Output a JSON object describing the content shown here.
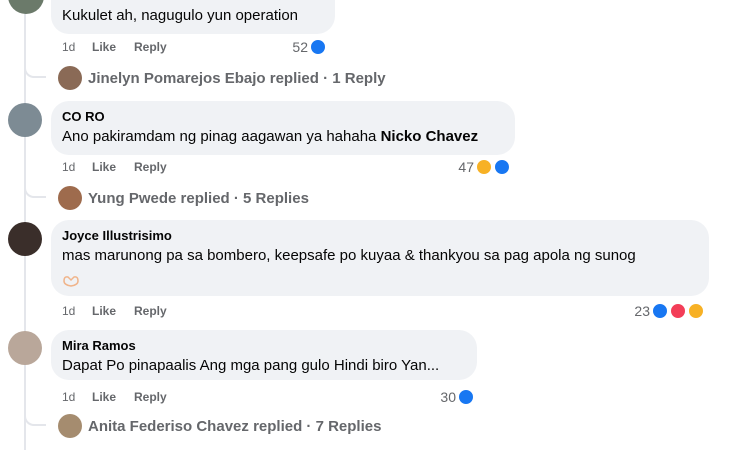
{
  "comments": [
    {
      "text": "Kukulet ah, nagugulo yun operation",
      "time": "1d",
      "like_label": "Like",
      "reply_label": "Reply",
      "reaction_count": "52",
      "reactions": [
        "like-icon"
      ],
      "replies": {
        "name": "Jinelyn Pomarejos Ebajo",
        "suffix": "replied · 1 Reply"
      }
    },
    {
      "author": "CO RO",
      "text": "Ano pakiramdam ng pinag aagawan ya hahaha",
      "mention": "Nicko Chavez",
      "time": "1d",
      "like_label": "Like",
      "reply_label": "Reply",
      "reaction_count": "47",
      "reactions": [
        "haha-icon",
        "like-icon"
      ],
      "replies": {
        "name": "Yung Pwede",
        "suffix": "replied · 5 Replies"
      }
    },
    {
      "author": "Joyce Illustrisimo",
      "text": "mas marunong pa sa bombero, keepsafe po kuyaa & thankyou sa pag apola ng sunog",
      "time": "1d",
      "like_label": "Like",
      "reply_label": "Reply",
      "reaction_count": "23",
      "reactions": [
        "like-icon",
        "love-icon",
        "care-icon"
      ]
    },
    {
      "author": "Mira Ramos",
      "text": "Dapat Po pinapaalis Ang mga pang gulo Hindi biro Yan...",
      "time": "1d",
      "like_label": "Like",
      "reply_label": "Reply",
      "reaction_count": "30",
      "reactions": [
        "like-icon"
      ],
      "replies": {
        "name": "Anita Federiso Chavez",
        "suffix": "replied · 7 Replies"
      }
    }
  ]
}
